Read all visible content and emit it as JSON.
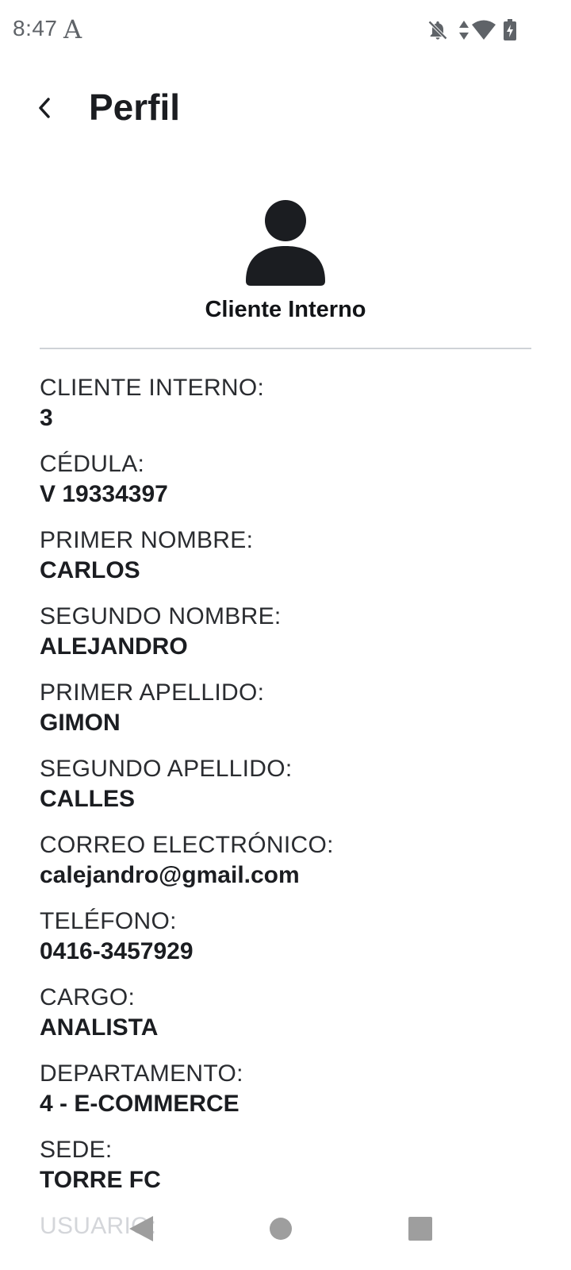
{
  "status_bar": {
    "time": "8:47",
    "app_icon_glyph": "A",
    "icons": [
      "notifications-off-icon",
      "data-arrows-icon",
      "wifi-icon",
      "battery-charging-icon"
    ]
  },
  "header": {
    "back_icon": "chevron-left-icon",
    "title": "Perfil"
  },
  "profile": {
    "avatar_icon": "person-icon",
    "subtitle": "Cliente Interno"
  },
  "fields": [
    {
      "label": "CLIENTE INTERNO:",
      "value": "3"
    },
    {
      "label": "CÉDULA:",
      "value": "V 19334397"
    },
    {
      "label": "PRIMER NOMBRE:",
      "value": "CARLOS"
    },
    {
      "label": "SEGUNDO NOMBRE:",
      "value": "ALEJANDRO"
    },
    {
      "label": "PRIMER APELLIDO:",
      "value": "GIMON"
    },
    {
      "label": "SEGUNDO APELLIDO:",
      "value": "CALLES"
    },
    {
      "label": "CORREO ELECTRÓNICO:",
      "value": "calejandro@gmail.com"
    },
    {
      "label": "TELÉFONO:",
      "value": "0416-3457929"
    },
    {
      "label": "CARGO:",
      "value": "ANALISTA"
    },
    {
      "label": "DEPARTAMENTO:",
      "value": "4 - E-COMMERCE"
    },
    {
      "label": "SEDE:",
      "value": "TORRE FC"
    },
    {
      "label": "USUARIO:",
      "value": ""
    }
  ],
  "nav_bar": {
    "icons": [
      "back-triangle-icon",
      "home-circle-icon",
      "recents-square-icon"
    ]
  },
  "colors": {
    "text_primary": "#1b1d21",
    "divider": "#cfd2d7",
    "status_icons": "#5f6368",
    "nav_icons": "#9e9e9e"
  }
}
